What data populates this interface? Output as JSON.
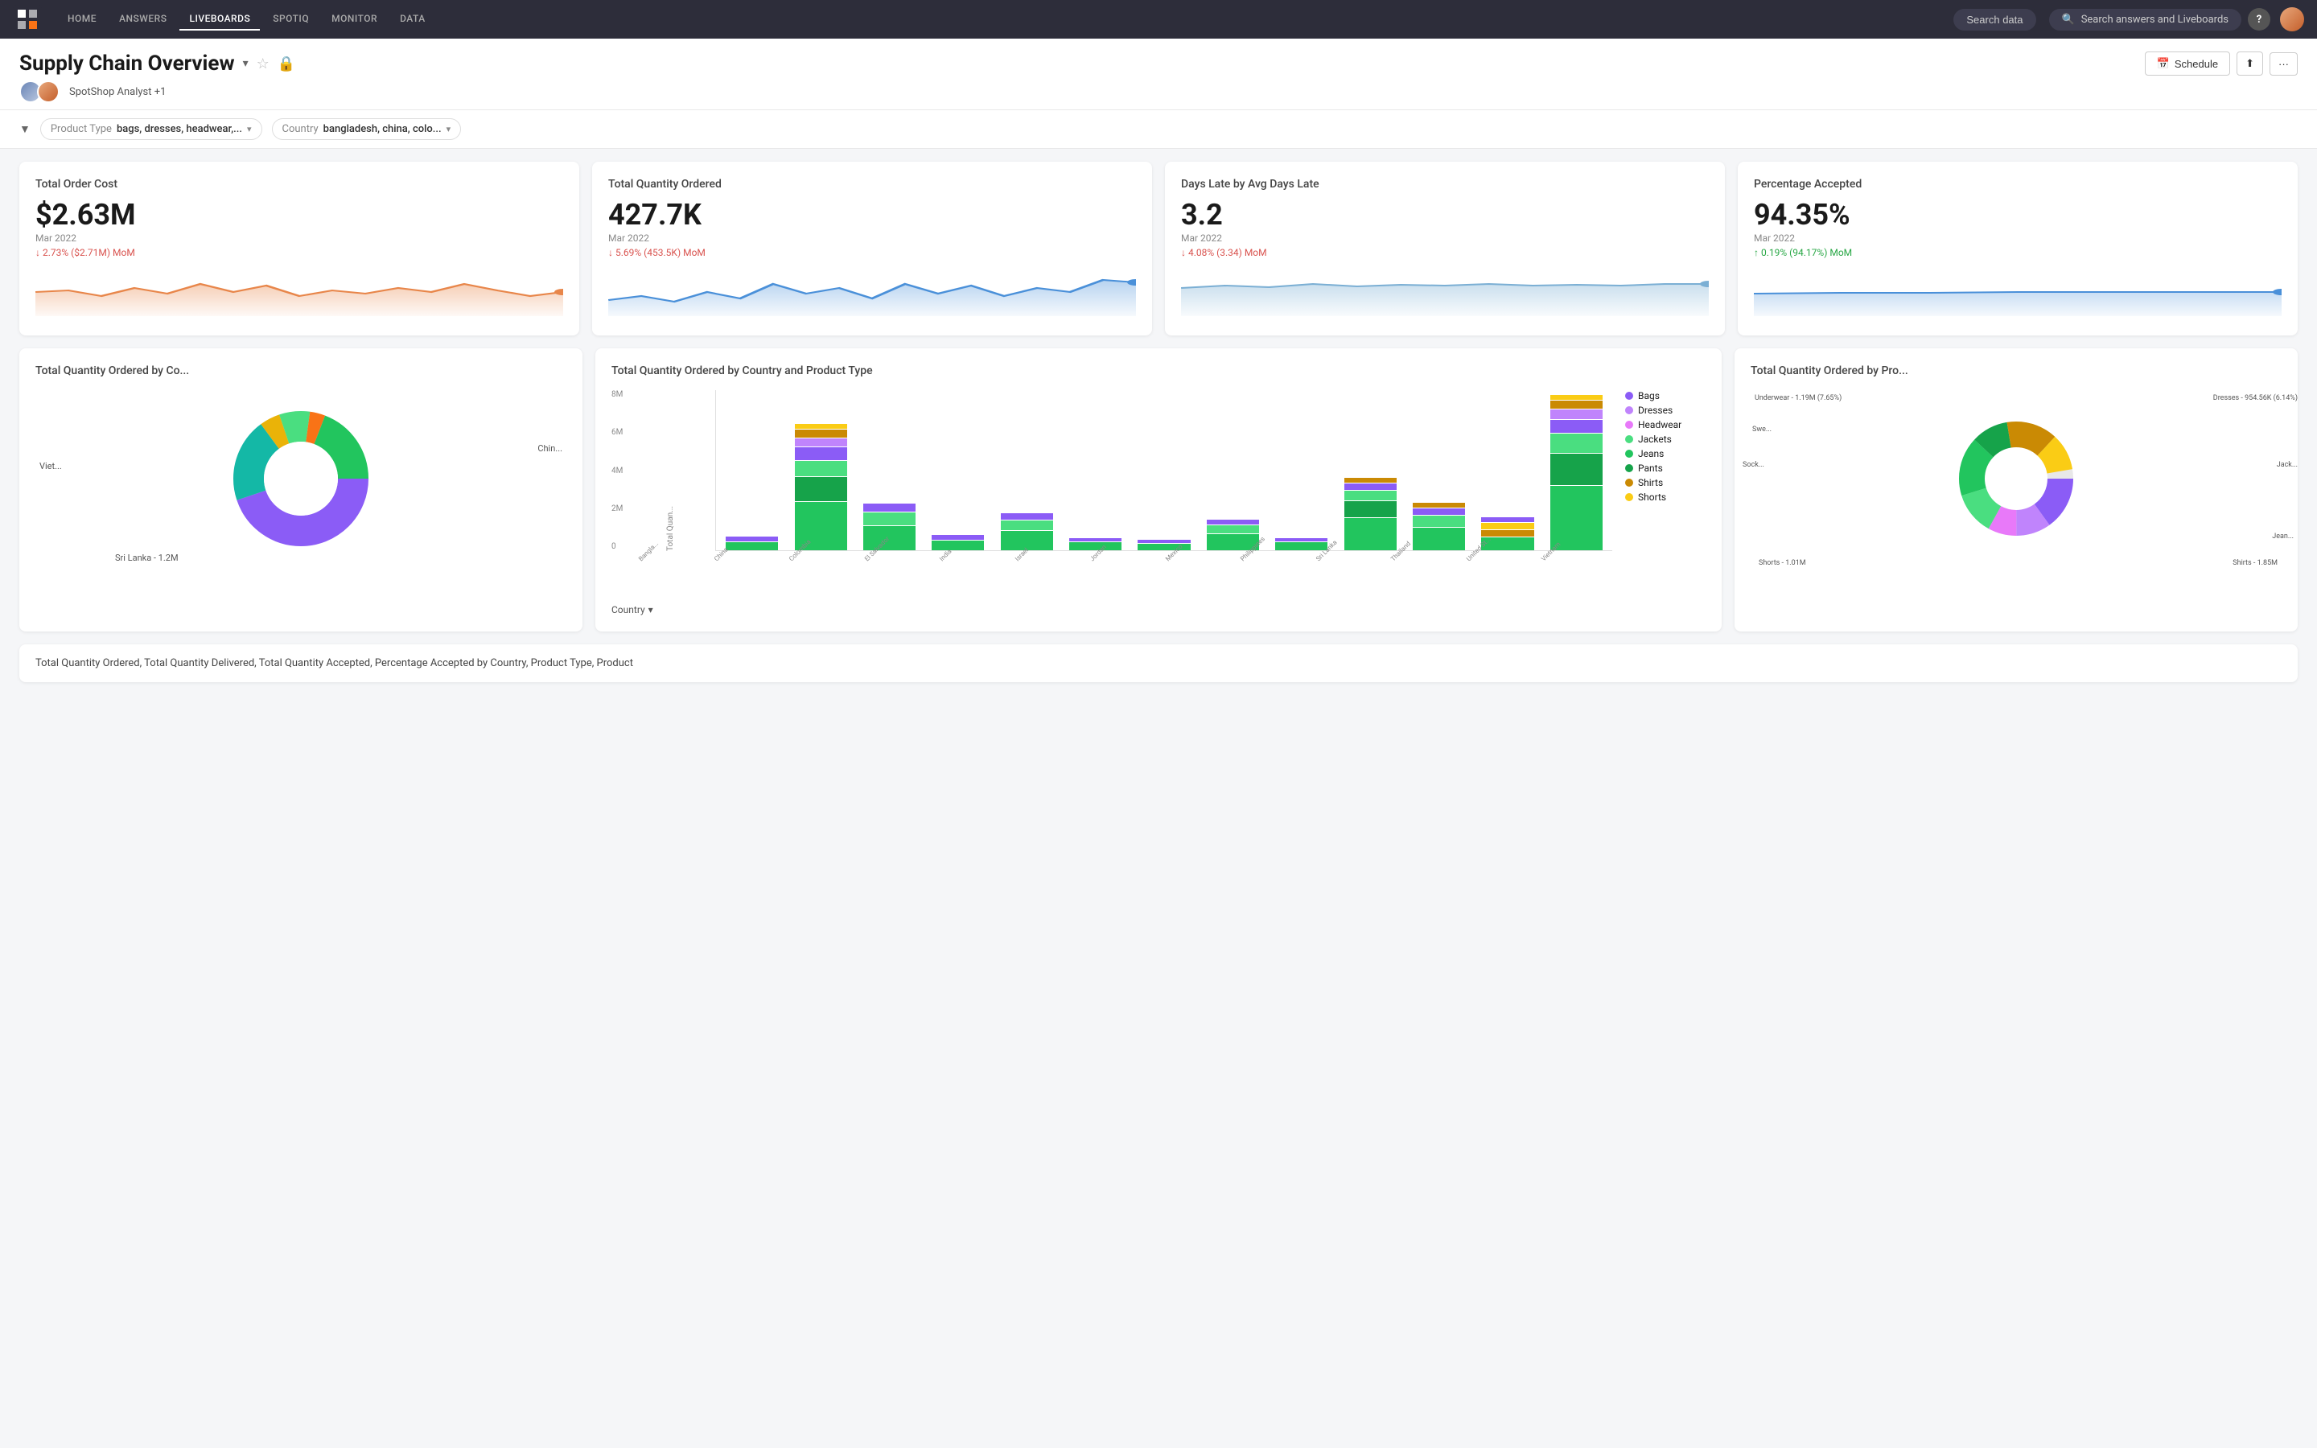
{
  "nav": {
    "links": [
      "HOME",
      "ANSWERS",
      "LIVEBOARDS",
      "SPOTIQ",
      "MONITOR",
      "DATA"
    ],
    "active_link": "LIVEBOARDS",
    "search_data_placeholder": "Search data",
    "search_answers_placeholder": "Search answers and Liveboards"
  },
  "header": {
    "title": "Supply Chain Overview",
    "analyst": "SpotShop Analyst +1",
    "schedule_label": "Schedule"
  },
  "filters": [
    {
      "label": "Product Type",
      "value": "bags, dresses, headwear,..."
    },
    {
      "label": "Country",
      "value": "bangladesh, china, colo..."
    }
  ],
  "kpis": [
    {
      "title": "Total Order Cost",
      "value": "$2.63M",
      "period": "Mar 2022",
      "change": "2.73% ($2.71M) MoM",
      "change_direction": "negative",
      "sparkline_color": "#e8864a"
    },
    {
      "title": "Total Quantity Ordered",
      "value": "427.7K",
      "period": "Mar 2022",
      "change": "5.69% (453.5K) MoM",
      "change_direction": "negative",
      "sparkline_color": "#4a90d9"
    },
    {
      "title": "Days Late by Avg Days Late",
      "value": "3.2",
      "period": "Mar 2022",
      "change": "4.08% (3.34) MoM",
      "change_direction": "negative",
      "sparkline_color": "#7bafd4"
    },
    {
      "title": "Percentage Accepted",
      "value": "94.35%",
      "period": "Mar 2022",
      "change": "0.19% (94.17%) MoM",
      "change_direction": "positive",
      "sparkline_color": "#4a90d9"
    }
  ],
  "charts": {
    "donut_country": {
      "title": "Total Quantity Ordered by Co...",
      "labels": {
        "china": "Chin...",
        "vietnam": "Viet...",
        "sri_lanka": "Sri Lanka - 1.2M"
      }
    },
    "bar_country_product": {
      "title": "Total Quantity Ordered by Country and Product Type",
      "y_labels": [
        "8M",
        "6M",
        "4M",
        "2M",
        "0"
      ],
      "x_labels": [
        "Bangla...",
        "China",
        "Colombia",
        "El Salvador",
        "India",
        "Israel",
        "Jordan",
        "Mexico",
        "Philippines",
        "Sri Lanka",
        "Thailand",
        "United St...",
        "Vietnam"
      ],
      "legend": [
        {
          "name": "Bags",
          "color": "#8b5cf6"
        },
        {
          "name": "Dresses",
          "color": "#c084fc"
        },
        {
          "name": "Headwear",
          "color": "#e879f9"
        },
        {
          "name": "Jackets",
          "color": "#4ade80"
        },
        {
          "name": "Jeans",
          "color": "#22c55e"
        },
        {
          "name": "Pants",
          "color": "#16a34a"
        },
        {
          "name": "Shirts",
          "color": "#ca8a04"
        },
        {
          "name": "Shorts",
          "color": "#facc15"
        }
      ],
      "country_dropdown_label": "Country"
    },
    "donut_product": {
      "title": "Total Quantity Ordered by Pro...",
      "labels": {
        "underwear": "Underwear - 1.19M (7.65%)",
        "dresses": "Dresses - 954.56K (6.14%)",
        "jackets": "Jack...",
        "jeans": "Jean...",
        "shirts": "Shirts - 1.85M",
        "shorts": "Shorts - 1.01M",
        "socks": "Sock...",
        "sweaters": "Swe..."
      }
    }
  },
  "bottom_text": "Total Quantity Ordered, Total Quantity Delivered, Total Quantity Accepted, Percentage Accepted by Country, Product Type, Product"
}
